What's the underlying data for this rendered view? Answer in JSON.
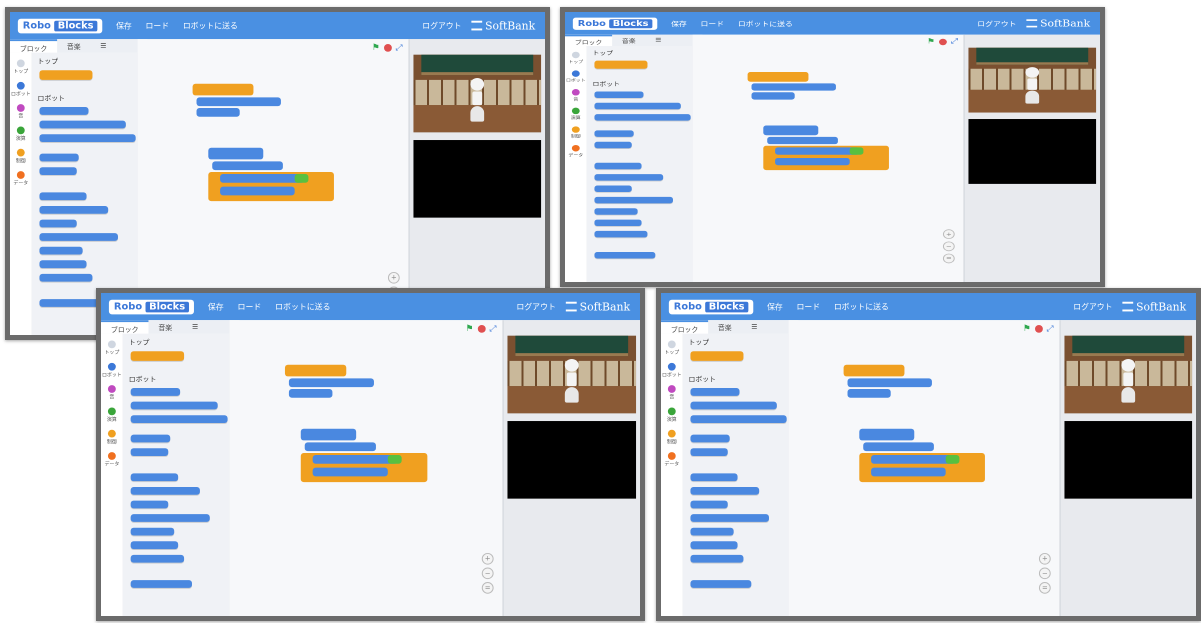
{
  "app": {
    "logo_left": "Robo",
    "logo_right": "Blocks",
    "menu": {
      "save": "保存",
      "load": "ロード",
      "send": "ロボットに送る"
    },
    "logout": "ログアウト",
    "brand": "SoftBank"
  },
  "tabs": {
    "blocks": "ブロック",
    "sounds": "音楽",
    "extra": "☰"
  },
  "categories": [
    {
      "label": "トップ",
      "color": "#3c78d8"
    },
    {
      "label": "ロボット",
      "color": "#3c78d8"
    },
    {
      "label": "音",
      "color": "#c04ac0"
    },
    {
      "label": "演算",
      "color": "#3aa53a"
    },
    {
      "label": "制御",
      "color": "#f0a020"
    },
    {
      "label": "データ",
      "color": "#f07020"
    }
  ],
  "palette_sections": {
    "top": "トップ",
    "robot": "ロボット"
  },
  "icons": {
    "flag": "green-flag-icon",
    "stop": "stop-icon",
    "expand": "expand-icon"
  },
  "zoom": {
    "in": "+",
    "out": "−",
    "reset": "="
  },
  "colors": {
    "header": "#4a90e2",
    "block_blue": "#4a88e0",
    "block_orange": "#f0a020",
    "block_green": "#58c040"
  }
}
